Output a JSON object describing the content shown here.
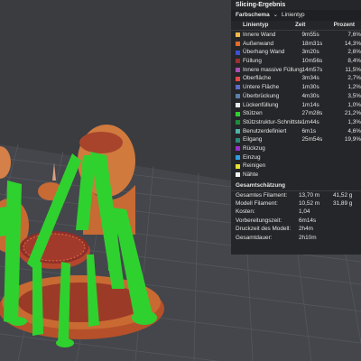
{
  "panel": {
    "title": "Slicing-Ergebnis",
    "scheme_label": "Farbschema",
    "scheme_value": "Linientyp",
    "headers": {
      "type": "Linientyp",
      "time": "Zeit",
      "percent": "Prozent"
    },
    "rows": [
      {
        "label": "Innere Wand",
        "time": "9m55s",
        "percent": "7,6%",
        "color": "#f0b84a"
      },
      {
        "label": "Außenwand",
        "time": "18m31s",
        "percent": "14,3%",
        "color": "#e06b2a"
      },
      {
        "label": "Überhang Wand",
        "time": "3m20s",
        "percent": "2,6%",
        "color": "#3c4fd1"
      },
      {
        "label": "Füllung",
        "time": "10m56s",
        "percent": "8,4%",
        "color": "#9c2f2f"
      },
      {
        "label": "Innere massive Füllung",
        "time": "14m57s",
        "percent": "11,5%",
        "color": "#a84fb3"
      },
      {
        "label": "Oberfläche",
        "time": "3m34s",
        "percent": "2,7%",
        "color": "#e24848"
      },
      {
        "label": "Untere Fläche",
        "time": "1m30s",
        "percent": "1,2%",
        "color": "#5c6bc8"
      },
      {
        "label": "Überbrückung",
        "time": "4m30s",
        "percent": "3,5%",
        "color": "#5a7fa8"
      },
      {
        "label": "Lückenfüllung",
        "time": "1m14s",
        "percent": "1,0%",
        "color": "#e8e8e8"
      },
      {
        "label": "Stützen",
        "time": "27m28s",
        "percent": "21,2%",
        "color": "#2fd12f"
      },
      {
        "label": "Stützstruktur-Schnittstelle",
        "time": "1m44s",
        "percent": "1,3%",
        "color": "#1f8a3a"
      },
      {
        "label": "Benutzerdefiniert",
        "time": "6m1s",
        "percent": "4,6%",
        "color": "#4fb3a8"
      },
      {
        "label": "Eilgang",
        "time": "25m54s",
        "percent": "19,9%",
        "color": "#2a8a7a"
      },
      {
        "label": "Rückzug",
        "time": "",
        "percent": "",
        "color": "#9a2fd1"
      },
      {
        "label": "Einzug",
        "time": "",
        "percent": "",
        "color": "#2f9fe0"
      },
      {
        "label": "Reinigen",
        "time": "",
        "percent": "",
        "color": "#e8e02f"
      },
      {
        "label": "Nähte",
        "time": "",
        "percent": "",
        "color": "#f2f2f2"
      }
    ],
    "summary_title": "Gesamtschätzung",
    "summary": [
      {
        "label": "Gesamtes Filament:",
        "v1": "13,70 m",
        "v2": "41,52 g"
      },
      {
        "label": "Modell Filament:",
        "v1": "10,52 m",
        "v2": "31,89 g"
      },
      {
        "label": "Kosten:",
        "v1": "1,04",
        "v2": ""
      },
      {
        "label": "Vorbereitungszeit:",
        "v1": "6m14s",
        "v2": ""
      },
      {
        "label": "Druckzeit des Modell:",
        "v1": "2h4m",
        "v2": ""
      },
      {
        "label": "Gesamtdauer:",
        "v1": "2h10m",
        "v2": ""
      }
    ]
  }
}
